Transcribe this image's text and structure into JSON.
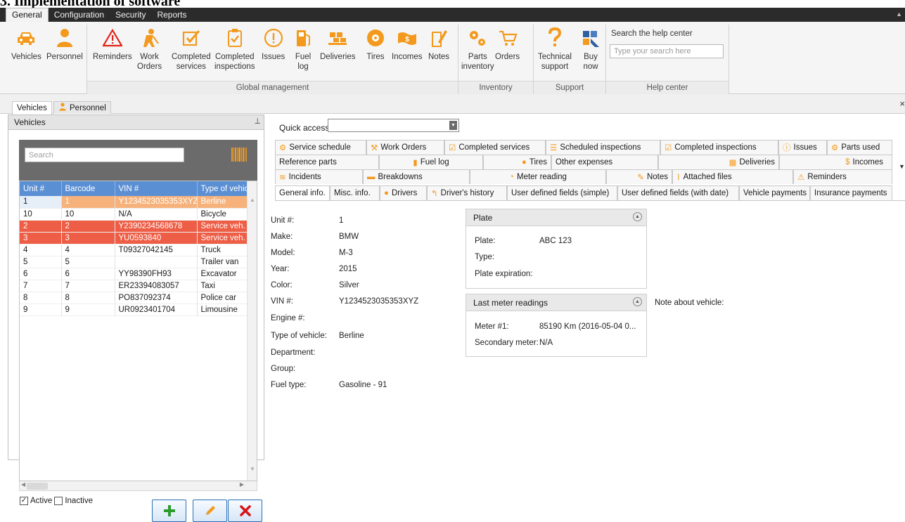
{
  "document_heading": "3. Implementation of software",
  "ribbon_tabs": [
    "General",
    "Configuration",
    "Security",
    "Reports"
  ],
  "ribbon": {
    "vehicles": "Vehicles",
    "personnel": "Personnel",
    "reminders": "Reminders",
    "work_orders_1": "Work",
    "work_orders_2": "Orders",
    "completed_services_1": "Completed",
    "completed_services_2": "services",
    "completed_inspections_1": "Completed",
    "completed_inspections_2": "inspections",
    "issues": "Issues",
    "fuel_log_1": "Fuel",
    "fuel_log_2": "log",
    "deliveries": "Deliveries",
    "tires": "Tires",
    "incomes": "Incomes",
    "notes": "Notes",
    "parts_inventory_1": "Parts",
    "parts_inventory_2": "inventory",
    "orders": "Orders",
    "technical_support_1": "Technical",
    "technical_support_2": "support",
    "buy_now_1": "Buy",
    "buy_now_2": "now",
    "help_title": "Search the help center",
    "help_placeholder": "Type your search here",
    "group_global": "Global management",
    "group_inventory": "Inventory",
    "group_support": "Support",
    "group_help": "Help center"
  },
  "doc_tabs": {
    "vehicles": "Vehicles",
    "personnel": "Personnel",
    "close": "×"
  },
  "left_panel": {
    "title": "Vehicles",
    "pin": "⊥",
    "search_placeholder": "Search",
    "columns": [
      "Unit #",
      "Barcode",
      "VIN #",
      "Type of vehic"
    ],
    "rows": [
      [
        "1",
        "1",
        "Y1234523035353XYZ",
        "Berline"
      ],
      [
        "10",
        "10",
        "N/A",
        "Bicycle"
      ],
      [
        "2",
        "2",
        "Y2390234568678",
        "Service veh."
      ],
      [
        "3",
        "3",
        "YU0593840",
        "Service veh."
      ],
      [
        "4",
        "4",
        "T09327042145",
        "Truck"
      ],
      [
        "5",
        "5",
        "",
        "Trailer van"
      ],
      [
        "6",
        "6",
        "YY98390FH93",
        "Excavator"
      ],
      [
        "7",
        "7",
        "ER23394083057",
        "Taxi"
      ],
      [
        "8",
        "8",
        "PO837092374",
        "Police car"
      ],
      [
        "9",
        "9",
        "UR0923401704",
        "Limousine"
      ]
    ],
    "active_label": "Active",
    "inactive_label": "Inactive",
    "active_checked": true,
    "inactive_checked": false
  },
  "quick_access_label": "Quick access:",
  "tab_rows": {
    "row1": [
      "Service schedule",
      "Work Orders",
      "Completed services",
      "Scheduled inspections",
      "Completed inspections",
      "Issues",
      "Parts used"
    ],
    "row2": [
      "Reference parts",
      "Fuel log",
      "Tires",
      "Other expenses",
      "Deliveries",
      "Incomes"
    ],
    "row3": [
      "Incidents",
      "Breakdowns",
      "Meter reading",
      "Notes",
      "Attached files",
      "Reminders"
    ],
    "row4": [
      "General info.",
      "Misc. info.",
      "Drivers",
      "Driver's history",
      "User defined fields (simple)",
      "User defined fields (with date)",
      "Vehicle payments",
      "Insurance payments"
    ]
  },
  "general_info": {
    "unit_label": "Unit #:",
    "unit_value": "1",
    "make_label": "Make:",
    "make_value": "BMW",
    "model_label": "Model:",
    "model_value": "M-3",
    "year_label": "Year:",
    "year_value": "2015",
    "color_label": "Color:",
    "color_value": "Silver",
    "vin_label": "VIN #:",
    "vin_value": "Y1234523035353XYZ",
    "engine_label": "Engine #:",
    "type_label": "Type of vehicle:",
    "type_value": "Berline",
    "department_label": "Department:",
    "group_label": "Group:",
    "fuel_label": "Fuel type:",
    "fuel_value": "Gasoline - 91"
  },
  "plate_card": {
    "title": "Plate",
    "plate_label": "Plate:",
    "plate_value": "ABC 123",
    "type_label": "Type:",
    "expiration_label": "Plate expiration:"
  },
  "meter_card": {
    "title": "Last meter readings",
    "meter1_label": "Meter #1:",
    "meter1_value": "85190 Km (2016-05-04 0...",
    "secondary_label": "Secondary meter:",
    "secondary_value": "N/A"
  },
  "note_label": "Note about vehicle:",
  "colors": {
    "ribbon_icon": "#f39a1e",
    "header_blue": "#5b8fd4",
    "row_selected": "#f6b27a",
    "row_red": "#ee5d45",
    "ribbon_dark": "#2b2b2b"
  }
}
